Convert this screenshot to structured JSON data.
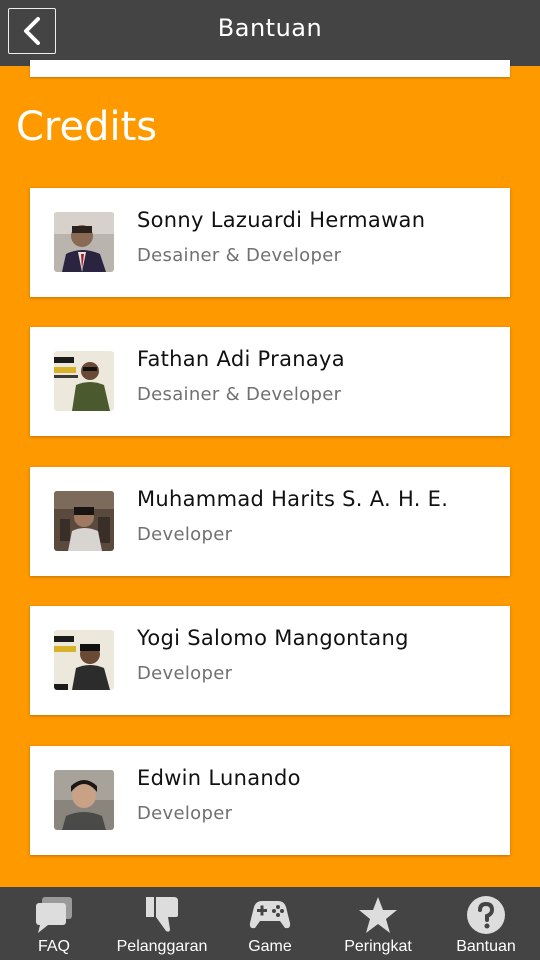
{
  "header": {
    "title": "Bantuan",
    "back_icon": "back-chevron-icon"
  },
  "section": {
    "heading": "Credits"
  },
  "credits": [
    {
      "name": "Sonny Lazuardi Hermawan",
      "role": "Desainer & Developer",
      "avatar": "avatar-photo"
    },
    {
      "name": "Fathan Adi Pranaya",
      "role": "Desainer & Developer",
      "avatar": "avatar-photo"
    },
    {
      "name": "Muhammad Harits S. A. H. E.",
      "role": "Developer",
      "avatar": "avatar-photo"
    },
    {
      "name": "Yogi Salomo Mangontang",
      "role": "Developer",
      "avatar": "avatar-photo"
    },
    {
      "name": "Edwin Lunando",
      "role": "Developer",
      "avatar": "avatar-photo"
    }
  ],
  "nav": [
    {
      "label": "FAQ",
      "icon": "chat-bubbles-icon"
    },
    {
      "label": "Pelanggaran",
      "icon": "thumbs-down-icon"
    },
    {
      "label": "Game",
      "icon": "gamepad-icon"
    },
    {
      "label": "Peringkat",
      "icon": "star-icon"
    },
    {
      "label": "Bantuan",
      "icon": "question-circle-icon"
    }
  ],
  "colors": {
    "accent": "#ff9900",
    "bar": "#444444",
    "card": "#ffffff"
  }
}
